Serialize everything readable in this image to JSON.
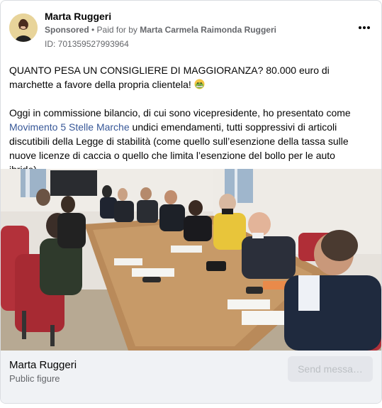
{
  "post": {
    "author_name": "Marta Ruggeri",
    "sponsored_label": "Sponsored",
    "separator": " • ",
    "paid_for_prefix": "Paid for by ",
    "paid_for_name": "Marta Carmela Raimonda Ruggeri",
    "id_label": "ID: 701359527993964",
    "more_icon": "more-horizontal-icon",
    "paragraph1_text": "QUANTO PESA UN CONSIGLIERE DI MAGGIORANZA? 80.000 euro di marchette a favore della propria clientela! ",
    "paragraph1_emoji": "nauseated-face-emoji",
    "paragraph2_prefix": "Oggi in commissione bilancio, di cui sono vicepresidente, ho presentato come ",
    "paragraph2_link": "Movimento 5 Stelle Marche",
    "paragraph2_suffix": " undici emendamenti, tutti soppressivi di articoli discutibili della Legge di stabilità (come quello sull’esenzione della tassa sulle nuove licenze di caccia o quello che limita l’esenzione del bollo per le auto ibride)…"
  },
  "footer": {
    "page_name": "Marta Ruggeri",
    "page_category": "Public figure",
    "send_button_label": "Send messa…"
  }
}
